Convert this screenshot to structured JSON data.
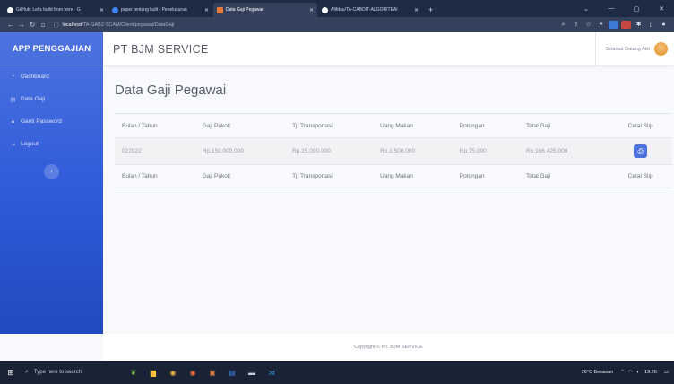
{
  "browser": {
    "tabs": [
      {
        "title": "GitHub: Let's build from here · G",
        "active": false,
        "fav_color": "#ffffff"
      },
      {
        "title": "paper tentang kulit - Penelusuran",
        "active": false,
        "fav_color": "#4285f4"
      },
      {
        "title": "Data Gaji Pegawai",
        "active": true,
        "fav_color": "#e8793a"
      },
      {
        "title": "Afifdau/TA-CABOIT-ALGORITEAI",
        "active": false,
        "fav_color": "#ffffff"
      }
    ],
    "url_host": "localhost",
    "url_path": "/TA-GAB2-SCAM/Client/pegawai/DataGaji"
  },
  "sidebar": {
    "brand": "APP PENGGAJIAN",
    "items": [
      {
        "label": "Dashboard",
        "icon": "dashboard-icon"
      },
      {
        "label": "Data Gaji",
        "icon": "table-icon"
      },
      {
        "label": "Ganti Password",
        "icon": "lock-icon"
      },
      {
        "label": "Logout",
        "icon": "logout-icon"
      }
    ]
  },
  "topbar": {
    "company": "PT BJM SERVICE",
    "greeting": "Selamat Datang Alzi"
  },
  "main": {
    "title": "Data Gaji Pegawai",
    "columns": [
      "Bulan / Tahun",
      "Gaji Pokok",
      "Tj. Transportasi",
      "Uang Makan",
      "Potongan",
      "Total Gaji",
      "Cetal Slip"
    ],
    "rows": [
      {
        "bulan_tahun": "022022",
        "gaji_pokok": "Rp.150.000.000",
        "tj_transportasi": "Rp.15.000.000",
        "uang_makan": "Rp.1.500.000",
        "potongan": "Rp.75.000",
        "total_gaji": "Rp.166.425.000"
      }
    ]
  },
  "footer": {
    "copyright": "Copyright © PT. BJM SERVICE"
  },
  "taskbar": {
    "search_placeholder": "Type here to search",
    "weather": "26°C Berawan",
    "time": "19:26"
  },
  "colors": {
    "sidebar_primary": "#4e73df",
    "print_button": "#4e73df"
  }
}
